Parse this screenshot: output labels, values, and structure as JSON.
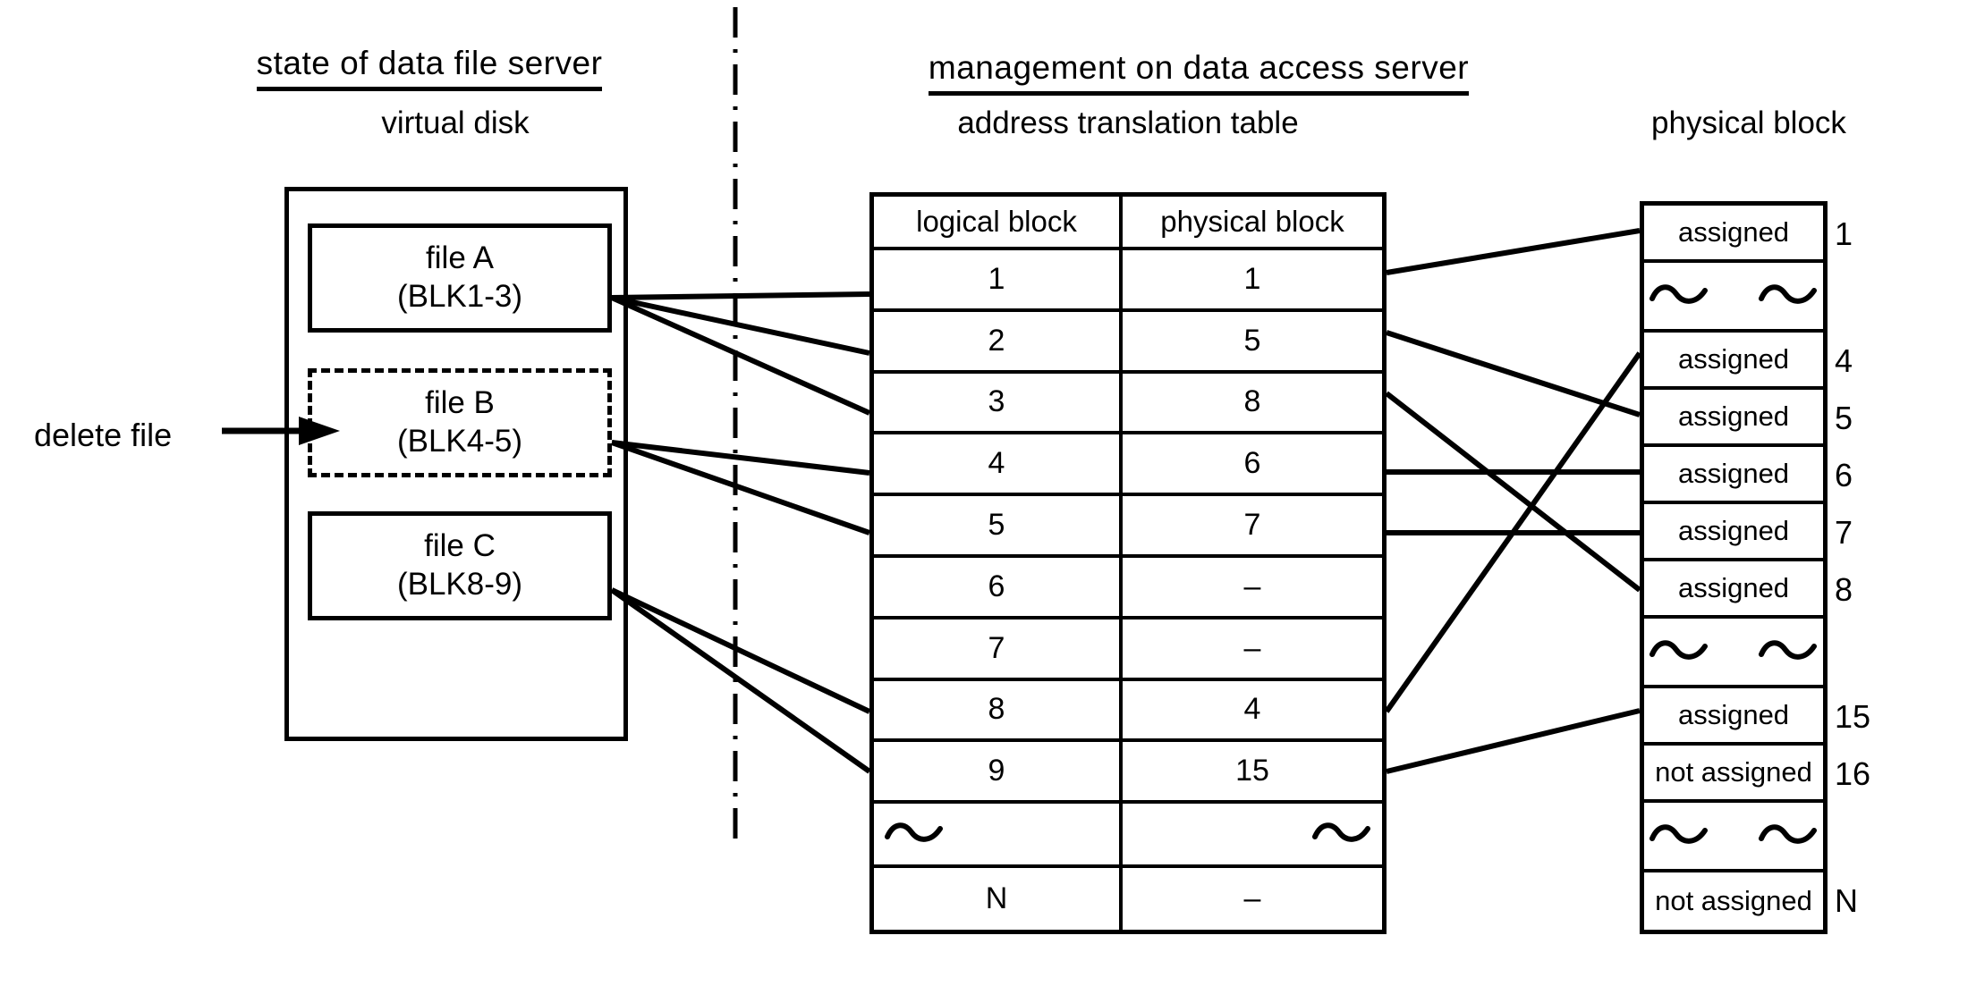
{
  "headings": {
    "left": "state of data file server",
    "right": "management on data access server"
  },
  "captions": {
    "virtual_disk": "virtual disk",
    "address_table": "address translation table",
    "physical_block": "physical block"
  },
  "annotation": {
    "delete_file": "delete file",
    "arrow_icon": "arrow-right-icon"
  },
  "virtual_disk": {
    "files": [
      {
        "name": "file A",
        "blocks": "(BLK1-3)",
        "state": "solid"
      },
      {
        "name": "file B",
        "blocks": "(BLK4-5)",
        "state": "dashed"
      },
      {
        "name": "file C",
        "blocks": "(BLK8-9)",
        "state": "solid"
      }
    ]
  },
  "address_table": {
    "columns": [
      "logical block",
      "physical block"
    ],
    "rows": [
      {
        "logical": "1",
        "physical": "1"
      },
      {
        "logical": "2",
        "physical": "5"
      },
      {
        "logical": "3",
        "physical": "8"
      },
      {
        "logical": "4",
        "physical": "6"
      },
      {
        "logical": "5",
        "physical": "7"
      },
      {
        "logical": "6",
        "physical": "–"
      },
      {
        "logical": "7",
        "physical": "–"
      },
      {
        "logical": "8",
        "physical": "4"
      },
      {
        "logical": "9",
        "physical": "15"
      },
      {
        "logical": "",
        "physical": "",
        "ellipsis": true
      },
      {
        "logical": "N",
        "physical": "–"
      }
    ]
  },
  "physical_block": {
    "rows": [
      {
        "state": "assigned",
        "number": "1"
      },
      {
        "state": "",
        "number": "",
        "ellipsis": true
      },
      {
        "state": "assigned",
        "number": "4"
      },
      {
        "state": "assigned",
        "number": "5"
      },
      {
        "state": "assigned",
        "number": "6"
      },
      {
        "state": "assigned",
        "number": "7"
      },
      {
        "state": "assigned",
        "number": "8"
      },
      {
        "state": "",
        "number": "",
        "ellipsis": true
      },
      {
        "state": "assigned",
        "number": "15"
      },
      {
        "state": "not assigned",
        "number": "16"
      },
      {
        "state": "",
        "number": "",
        "ellipsis": true
      },
      {
        "state": "not assigned",
        "number": "N"
      }
    ]
  },
  "colors": {
    "ink": "#000000",
    "paper": "#ffffff"
  }
}
